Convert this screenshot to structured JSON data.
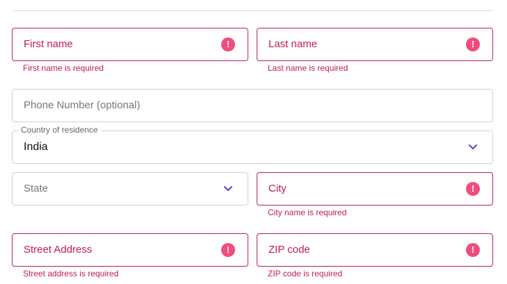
{
  "form": {
    "first_name": {
      "placeholder": "First name",
      "error": "First name is required"
    },
    "last_name": {
      "placeholder": "Last name",
      "error": "Last name is required"
    },
    "phone": {
      "placeholder": "Phone Number (optional)"
    },
    "country": {
      "label": "Country of residence",
      "value": "India"
    },
    "state": {
      "placeholder": "State"
    },
    "city": {
      "placeholder": "City",
      "error": "City name is required"
    },
    "street": {
      "placeholder": "Street Address",
      "error": "Street address is required"
    },
    "zip": {
      "placeholder": "ZIP code",
      "error": "ZIP code is required"
    },
    "error_icon_glyph": "!"
  },
  "colors": {
    "error": "#c2185b",
    "error_border": "#b3206b",
    "error_icon": "#f04d7e",
    "chevron": "#5b3fd6",
    "border": "#d2d2d2"
  },
  "icons": {
    "error": "exclamation-circle-icon",
    "dropdown": "chevron-down-icon"
  }
}
